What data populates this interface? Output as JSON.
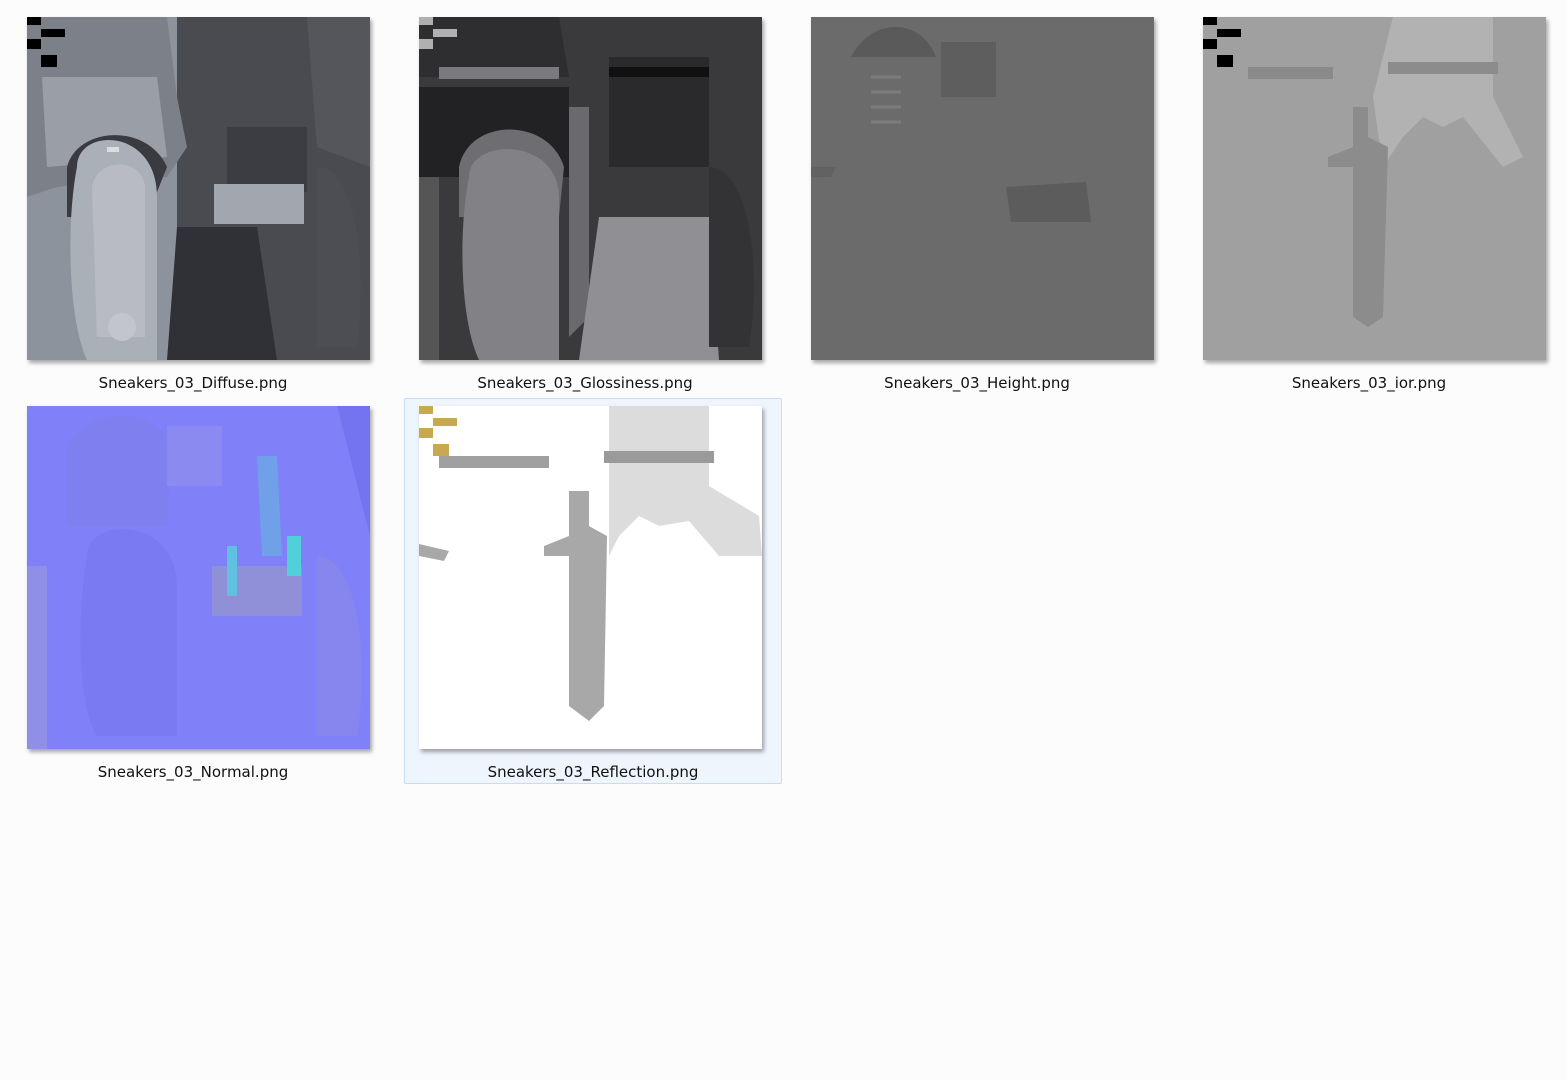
{
  "window": {
    "view": "Large icons"
  },
  "files": [
    {
      "name": "Sneakers_03_Diffuse.png",
      "map": "diffuse",
      "selected": false
    },
    {
      "name": "Sneakers_03_Glossiness.png",
      "map": "glossiness",
      "selected": false
    },
    {
      "name": "Sneakers_03_Height.png",
      "map": "height",
      "selected": false
    },
    {
      "name": "Sneakers_03_ior.png",
      "map": "ior",
      "selected": false
    },
    {
      "name": "Sneakers_03_Normal.png",
      "map": "normal",
      "selected": false
    },
    {
      "name": "Sneakers_03_Reflection.png",
      "map": "reflection",
      "selected": true
    }
  ],
  "colors": {
    "background": "#fcfcfc",
    "selection_fill": "#eef5fd",
    "selection_border": "#c8ddf3",
    "diffuse_base": "#8a9099",
    "glossiness_base": "#3a3a3c",
    "height_base": "#6a6a6a",
    "ior_base": "#a0a0a0",
    "normal_base": "#8080ff",
    "reflection_base": "#ffffff",
    "marker_gold": "#c8a850"
  }
}
